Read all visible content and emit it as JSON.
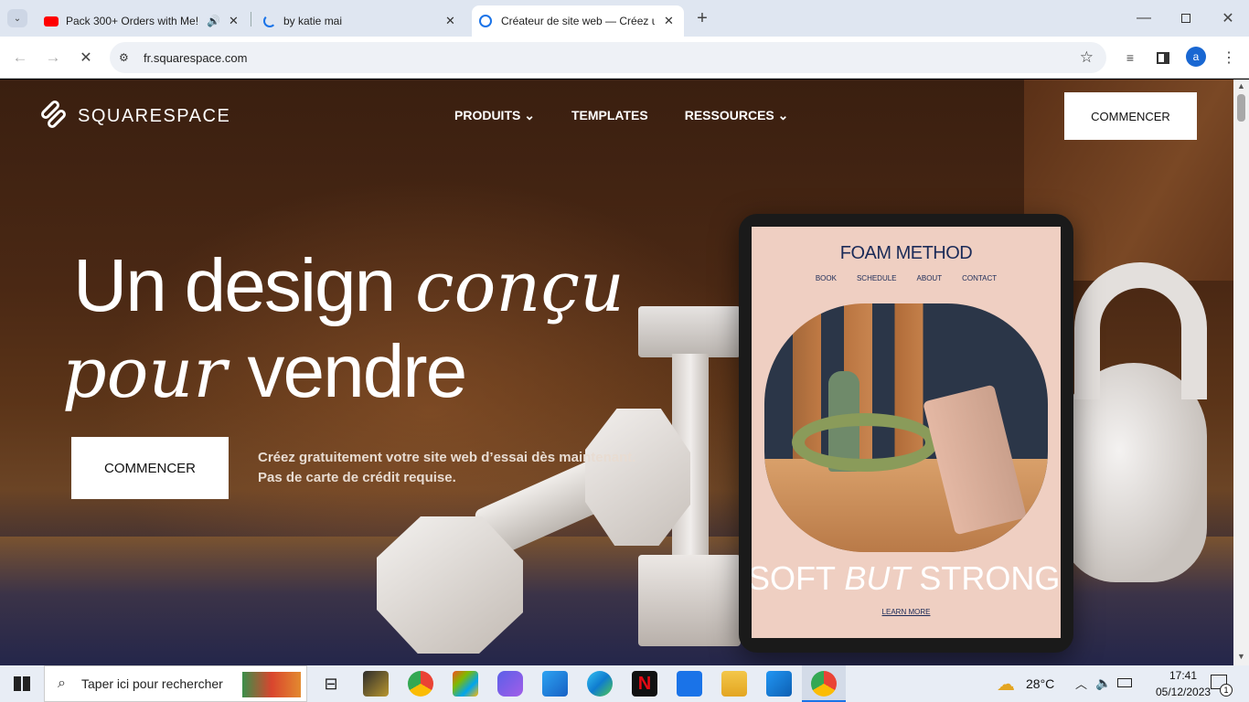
{
  "browser": {
    "tabs": [
      {
        "title": "Pack 300+ Orders with Me!",
        "active": false
      },
      {
        "title": "by katie mai",
        "active": false
      },
      {
        "title": "Créateur de site web — Créez un",
        "active": true
      }
    ],
    "url": "fr.squarespace.com",
    "profile_initial": "a"
  },
  "site": {
    "brand": "SQUARESPACE",
    "nav": {
      "products": "PRODUITS",
      "templates": "TEMPLATES",
      "resources": "RESSOURCES"
    },
    "header_cta": "COMMENCER",
    "hero": {
      "line1_sans": "Un design",
      "line1_serif": "conçu",
      "line2_serif": "pour",
      "line2_sans": "vendre",
      "cta": "COMMENCER",
      "sub1": "Créez gratuitement votre site web d’essai dès maintenant.",
      "sub2": "Pas de carte de crédit requise."
    },
    "tablet": {
      "title": "FOAM METHOD",
      "menu": [
        "BOOK",
        "SCHEDULE",
        "ABOUT",
        "CONTACT"
      ],
      "headline_a": "SOFT",
      "headline_b": "BUT",
      "headline_c": "STRONG",
      "link": "LEARN MORE"
    }
  },
  "taskbar": {
    "search_placeholder": "Taper ici pour rechercher",
    "weather": "28°C",
    "time": "17:41",
    "date": "05/12/2023",
    "notification_count": "1"
  },
  "colors": {
    "tabbar": "#dfe6f1",
    "hero_text": "#ffffff",
    "tablet_bg": "#efcfc2",
    "accent_blue": "#1a73e8"
  }
}
